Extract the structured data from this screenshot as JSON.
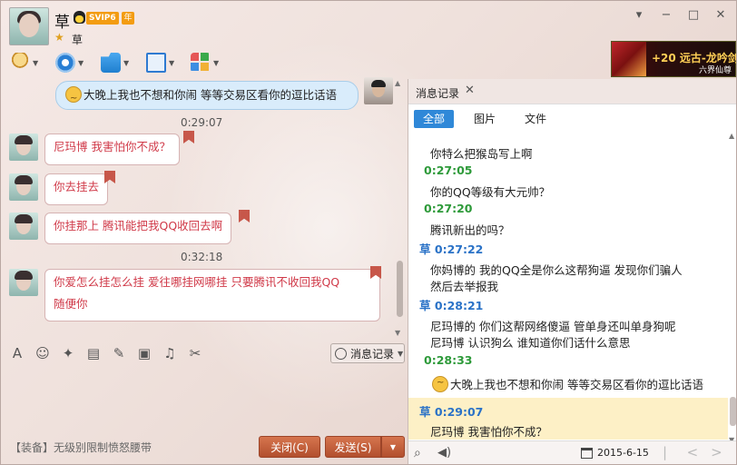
{
  "header": {
    "username": "草",
    "vip_badge": "SVIP6",
    "year_badge": "年",
    "signature": "草"
  },
  "window_controls": [
    "▾",
    "−",
    "□",
    "✕"
  ],
  "ad": {
    "title": "+20 远古-龙吟剑",
    "subtitle": "六界仙尊"
  },
  "chat": {
    "top_message": "大晚上我也不想和你闹 等等交易区看你的逗比话语",
    "time1": "0:29:07",
    "messages": [
      "尼玛博  我害怕你不成？",
      "你去挂去",
      "你挂那上  腾讯能把我QQ收回去啊"
    ],
    "time2": "0:32:18",
    "last_message_line1": "你爱怎么挂怎么挂 爱往哪挂网哪挂  只要腾讯不收回我QQ",
    "last_message_line2": "随便你"
  },
  "input_toolbar": {
    "msg_record_label": "消息记录"
  },
  "footer": {
    "equip_text": "【装备】无级别限制愤怒腰带",
    "close_label": "关闭(C)",
    "send_label": "发送(S)"
  },
  "history": {
    "tab_label": "消息记录",
    "filters": [
      "全部",
      "图片",
      "文件"
    ],
    "entries": [
      {
        "text": "你特么把猴岛写上啊"
      },
      {
        "time": "0:27:05"
      },
      {
        "text": "你的QQ等级有大元帅？"
      },
      {
        "time": "0:27:20"
      },
      {
        "text": "腾讯新出的吗？"
      },
      {
        "sender": "草",
        "time": "0:27:22"
      },
      {
        "text": "你妈博的  我的QQ全是你么这帮狗逼 发现你们骗人"
      },
      {
        "text": "然后去举报我"
      },
      {
        "sender": "草",
        "time": "0:28:21"
      },
      {
        "text": "尼玛博的  你们这帮网络傻逼  管单身还叫单身狗呢"
      },
      {
        "text": "尼玛博 认识狗么 谁知道你们话什么意思"
      },
      {
        "time": "0:28:33"
      },
      {
        "text": "大晚上我也不想和你闹 等等交易区看你的逗比话语"
      },
      {
        "sender": "草",
        "time": "0:29:07"
      },
      {
        "text": "尼玛博  我害怕你不成？"
      }
    ],
    "date": "2015-6-15"
  },
  "colors": {
    "accent": "#2f88d8",
    "message_red": "#d03a49",
    "time_green": "#2e9a3a",
    "send_button": "#c45f3b"
  }
}
